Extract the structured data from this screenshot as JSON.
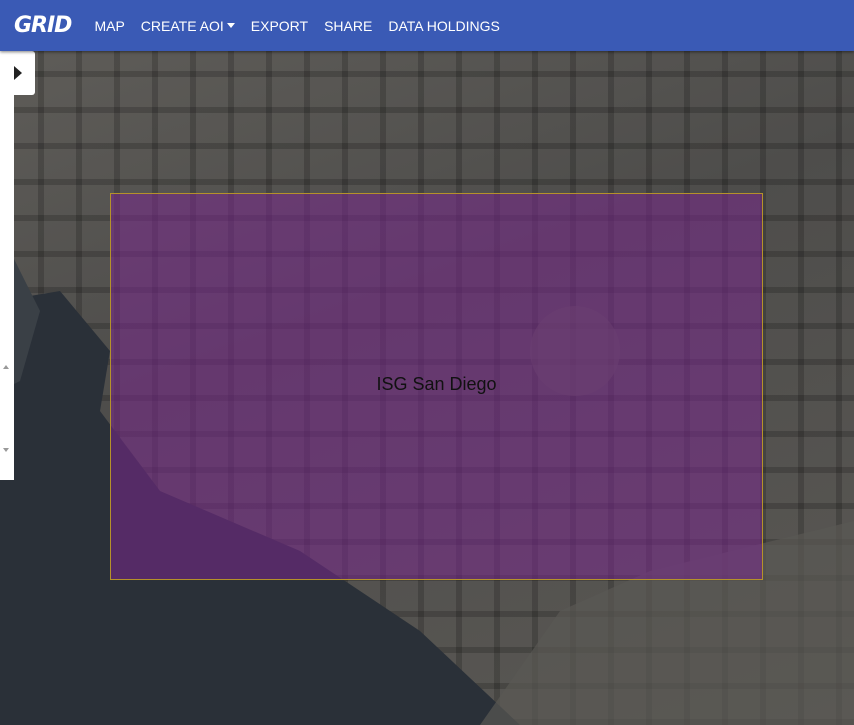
{
  "app": {
    "logo": "GRID"
  },
  "nav": {
    "items": [
      {
        "label": "MAP"
      },
      {
        "label": "CREATE AOI"
      },
      {
        "label": "EXPORT"
      },
      {
        "label": "SHARE"
      },
      {
        "label": "DATA HOLDINGS"
      }
    ]
  },
  "map": {
    "aoi_label": "ISG San Diego",
    "aoi_color": "#7a2a8c",
    "aoi_border": "#b5922a"
  },
  "icons": {
    "panel_toggle": "chevron-right-icon",
    "dropdown": "caret-down-icon"
  }
}
